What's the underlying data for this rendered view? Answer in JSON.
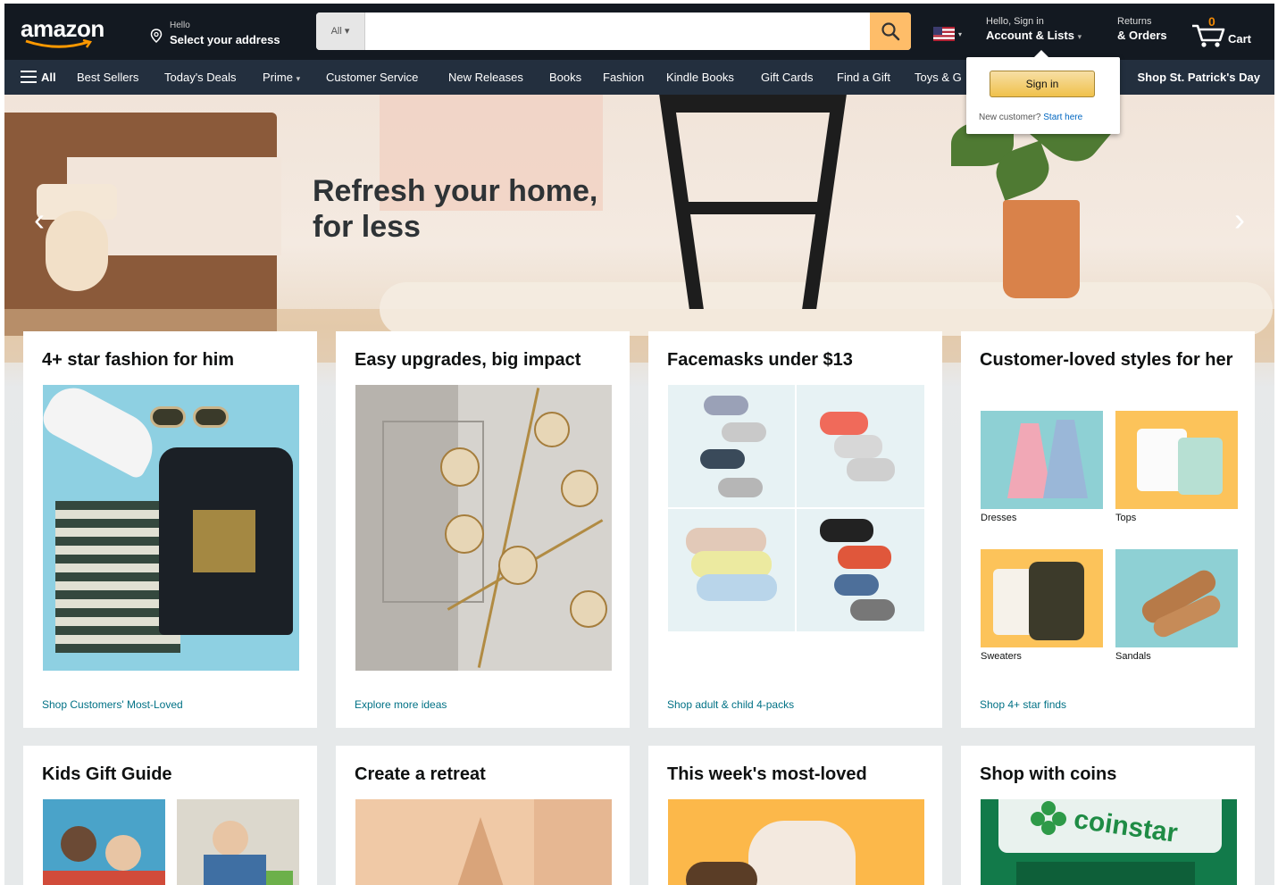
{
  "header": {
    "logo_text": "amazon",
    "address_line1": "Hello",
    "address_line2": "Select your address",
    "search_category": "All",
    "search_placeholder": "",
    "account_line1": "Hello, Sign in",
    "account_line2": "Account & Lists",
    "orders_line1": "Returns",
    "orders_line2": "& Orders",
    "cart_count": "0",
    "cart_label": "Cart"
  },
  "subnav": {
    "all_label": "All",
    "items": [
      "Best Sellers",
      "Today's Deals",
      "Prime",
      "Customer Service",
      "New Releases",
      "Books",
      "Fashion",
      "Kindle Books",
      "Gift Cards",
      "Find a Gift",
      "Toys & G"
    ],
    "promo": "Shop St. Patrick's Day"
  },
  "flyout": {
    "button": "Sign in",
    "new_customer": "New customer?",
    "start_here": "Start here"
  },
  "hero": {
    "title_line1": "Refresh your home,",
    "title_line2": "for less"
  },
  "cards_row1": [
    {
      "title": "4+ star fashion for him",
      "link": "Shop Customers' Most-Loved"
    },
    {
      "title": "Easy upgrades, big impact",
      "link": "Explore more ideas"
    },
    {
      "title": "Facemasks under $13",
      "link": "Shop adult & child 4-packs"
    },
    {
      "title": "Customer-loved styles for her",
      "link": "Shop 4+ star finds",
      "tiles": [
        "Dresses",
        "Tops",
        "Sweaters",
        "Sandals"
      ]
    }
  ],
  "cards_row2": [
    {
      "title": "Kids Gift Guide"
    },
    {
      "title": "Create a retreat"
    },
    {
      "title": "This week's most-loved"
    },
    {
      "title": "Shop with coins",
      "brand": "coinstar"
    }
  ],
  "colors": {
    "nav_dark": "#131921",
    "nav_sub": "#232f3e",
    "search_button": "#febd69",
    "link": "#007185",
    "cart_count": "#f08804"
  }
}
